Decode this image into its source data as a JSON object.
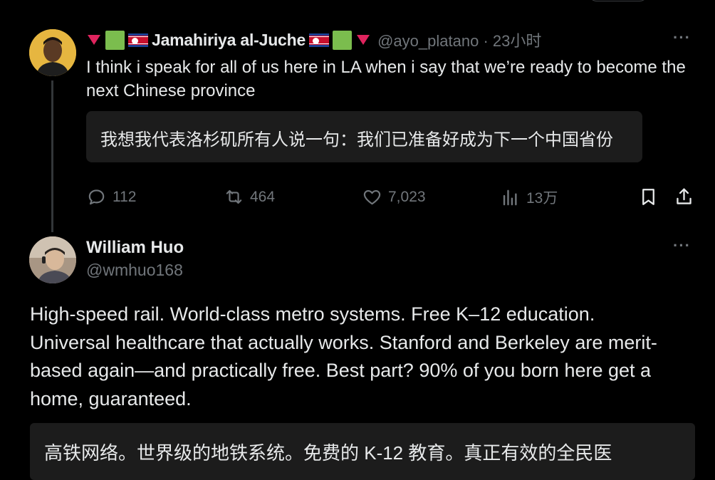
{
  "tweet1": {
    "display_name": "Jamahiriya al-Juche",
    "handle": "@ayo_platano",
    "separator": "·",
    "time": "23小时",
    "text": "I think i speak for all of us here in LA when i say that we’re ready to become the next Chinese province",
    "translation": "我想我代表洛杉矶所有人说一句：我们已准备好成为下一个中国省份",
    "actions": {
      "replies": "112",
      "reposts": "464",
      "likes": "7,023",
      "views": "13万"
    },
    "more_label": "···"
  },
  "tweet2": {
    "display_name": "William Huo",
    "handle": "@wmhuo168",
    "text": "High-speed rail. World-class metro systems. Free K–12 education. Universal healthcare that actually works. Stanford and Berkeley are merit-based again—and practically free. Best part? 90% of you born here get a home, guaranteed.",
    "translation": "高铁网络。世界级的地铁系统。免费的 K-12 教育。真正有效的全民医",
    "more_label": "···"
  },
  "colors": {
    "background": "#000000",
    "text": "#e7e9ea",
    "muted": "#71767b",
    "translation_bg": "#1c1c1c",
    "thread_line": "#333639"
  },
  "icons": [
    "reply-icon",
    "repost-icon",
    "like-icon",
    "views-icon",
    "bookmark-icon",
    "share-icon",
    "more-icon",
    "red-triangle-icon",
    "green-square-icon",
    "north-korea-flag-icon"
  ]
}
